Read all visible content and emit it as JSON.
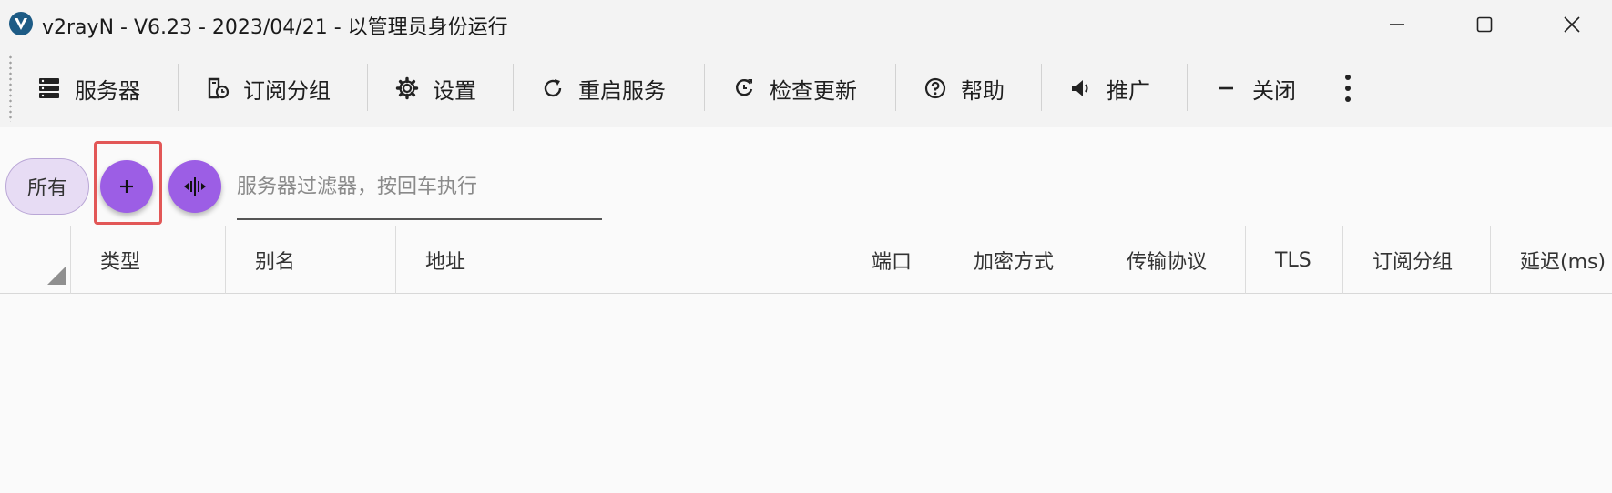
{
  "window": {
    "title": "v2rayN - V6.23 - 2023/04/21 - 以管理员身份运行",
    "logo_letter": "V"
  },
  "toolbar": {
    "items": [
      {
        "label": "服务器",
        "icon": "server-icon"
      },
      {
        "label": "订阅分组",
        "icon": "subscription-group-icon"
      },
      {
        "label": "设置",
        "icon": "gear-icon"
      },
      {
        "label": "重启服务",
        "icon": "restart-icon"
      },
      {
        "label": "检查更新",
        "icon": "update-icon"
      },
      {
        "label": "帮助",
        "icon": "help-icon"
      },
      {
        "label": "推广",
        "icon": "speaker-icon"
      },
      {
        "label": "关闭",
        "icon": "minus-icon"
      }
    ],
    "more_icon": "more-vertical-icon"
  },
  "filter": {
    "group_chip": "所有",
    "add_icon": "plus-icon",
    "split_icon": "split-columns-icon",
    "placeholder": "服务器过滤器，按回车执行",
    "value": ""
  },
  "grid": {
    "columns": [
      "类型",
      "别名",
      "地址",
      "端口",
      "加密方式",
      "传输协议",
      "TLS",
      "订阅分组",
      "延迟(ms)"
    ],
    "rows": []
  },
  "colors": {
    "accent": "#9c5ee5",
    "chip_bg": "#e7dcf4",
    "highlight": "#e25757",
    "logo": "#1d5b85"
  }
}
